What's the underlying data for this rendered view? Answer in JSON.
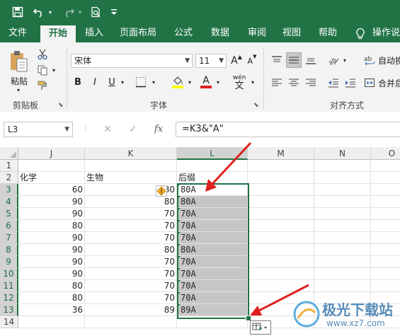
{
  "qat": {
    "save_icon": "save-icon",
    "undo_icon": "undo-icon",
    "redo_icon": "redo-icon",
    "preview_icon": "print-preview-icon",
    "customize_icon": "customize-toolbar-icon"
  },
  "tabs": [
    {
      "label": "文件"
    },
    {
      "label": "开始",
      "active": true
    },
    {
      "label": "插入"
    },
    {
      "label": "页面布局"
    },
    {
      "label": "公式"
    },
    {
      "label": "数据"
    },
    {
      "label": "审阅"
    },
    {
      "label": "视图"
    },
    {
      "label": "帮助"
    },
    {
      "label": "操作说"
    }
  ],
  "ribbon": {
    "clipboard": {
      "paste_label": "粘贴",
      "group_label": "剪贴板"
    },
    "font": {
      "font_name": "宋体",
      "font_size": "11",
      "bold": "B",
      "italic": "I",
      "underline": "U",
      "phonetic": "wén",
      "group_label": "字体",
      "grow": "A",
      "shrink": "A",
      "font_color": "A",
      "font_color_hex": "#e02020",
      "fill_color_hex": "#ffff00"
    },
    "alignment": {
      "wrap_label": "自动换",
      "merge_label": "合并后",
      "group_label": "对齐方式"
    }
  },
  "formula_bar": {
    "name_box": "L3",
    "cancel": "✕",
    "enter": "✓",
    "fx": "fx",
    "formula": "=K3&\"A\""
  },
  "sheet": {
    "columns": [
      "J",
      "K",
      "L",
      "M",
      "N",
      "O"
    ],
    "selected_column": "L",
    "rows": [
      "1",
      "2",
      "3",
      "4",
      "5",
      "6",
      "7",
      "8",
      "9",
      "10",
      "11",
      "12",
      "13",
      "14"
    ],
    "selected_rows": [
      "3",
      "4",
      "5",
      "6",
      "7",
      "8",
      "9",
      "10",
      "11",
      "12",
      "13"
    ],
    "headers": {
      "J": "化学",
      "K": "生物",
      "L": "后缀"
    },
    "data": [
      {
        "J": "60",
        "K": "80",
        "L": "80A"
      },
      {
        "J": "90",
        "K": "80",
        "L": "80A"
      },
      {
        "J": "90",
        "K": "70",
        "L": "70A"
      },
      {
        "J": "80",
        "K": "70",
        "L": "70A"
      },
      {
        "J": "90",
        "K": "70",
        "L": "70A"
      },
      {
        "J": "90",
        "K": "80",
        "L": "80A"
      },
      {
        "J": "90",
        "K": "70",
        "L": "70A"
      },
      {
        "J": "90",
        "K": "70",
        "L": "70A"
      },
      {
        "J": "80",
        "K": "70",
        "L": "70A"
      },
      {
        "J": "80",
        "K": "70",
        "L": "70A"
      },
      {
        "J": "36",
        "K": "89",
        "L": "89A"
      }
    ]
  },
  "colors": {
    "accent": "#217346",
    "arrow": "#e02020",
    "selection_fill": "#c6c6c6"
  },
  "watermark": {
    "title": "极光下载站",
    "url": "www.xz7.com"
  }
}
